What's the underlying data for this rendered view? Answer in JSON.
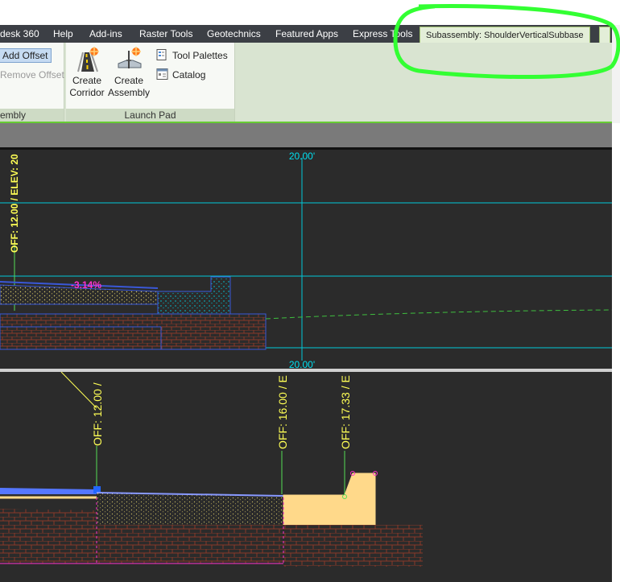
{
  "tabs": [
    "desk 360",
    "Help",
    "Add-ins",
    "Raster Tools",
    "Geotechnics",
    "Featured Apps",
    "Express Tools"
  ],
  "active_tab": "Subassembly: ShoulderVerticalSubbase",
  "ribbon": {
    "assembly_panel": {
      "add_offset": "Add Offset",
      "remove_offset": "Remove Offset",
      "title": "embly"
    },
    "launch_pad": {
      "title": "Launch Pad",
      "create_corridor": [
        "Create",
        "Corridor"
      ],
      "create_assembly": [
        "Create",
        "Assembly"
      ],
      "tool_palettes": "Tool Palettes",
      "catalog": "Catalog"
    }
  },
  "viewport_top": {
    "offset_label": "OFF: 12.00 / ELEV: 20",
    "grid_label_top": "20.00'",
    "grid_label_bottom": "20.00'",
    "slope_label": "-3.14%"
  },
  "viewport_bottom": {
    "labels": [
      "OFF: 12.00 /",
      "OFF: 16.00 / E",
      "OFF: 17.33 / E"
    ]
  },
  "colors": {
    "accent_green": "#33ff33",
    "cyan_grid": "#00d8e8",
    "yellow_label": "#ffff55",
    "magenta": "#ff33cc",
    "curb_fill": "#ffd98a"
  }
}
